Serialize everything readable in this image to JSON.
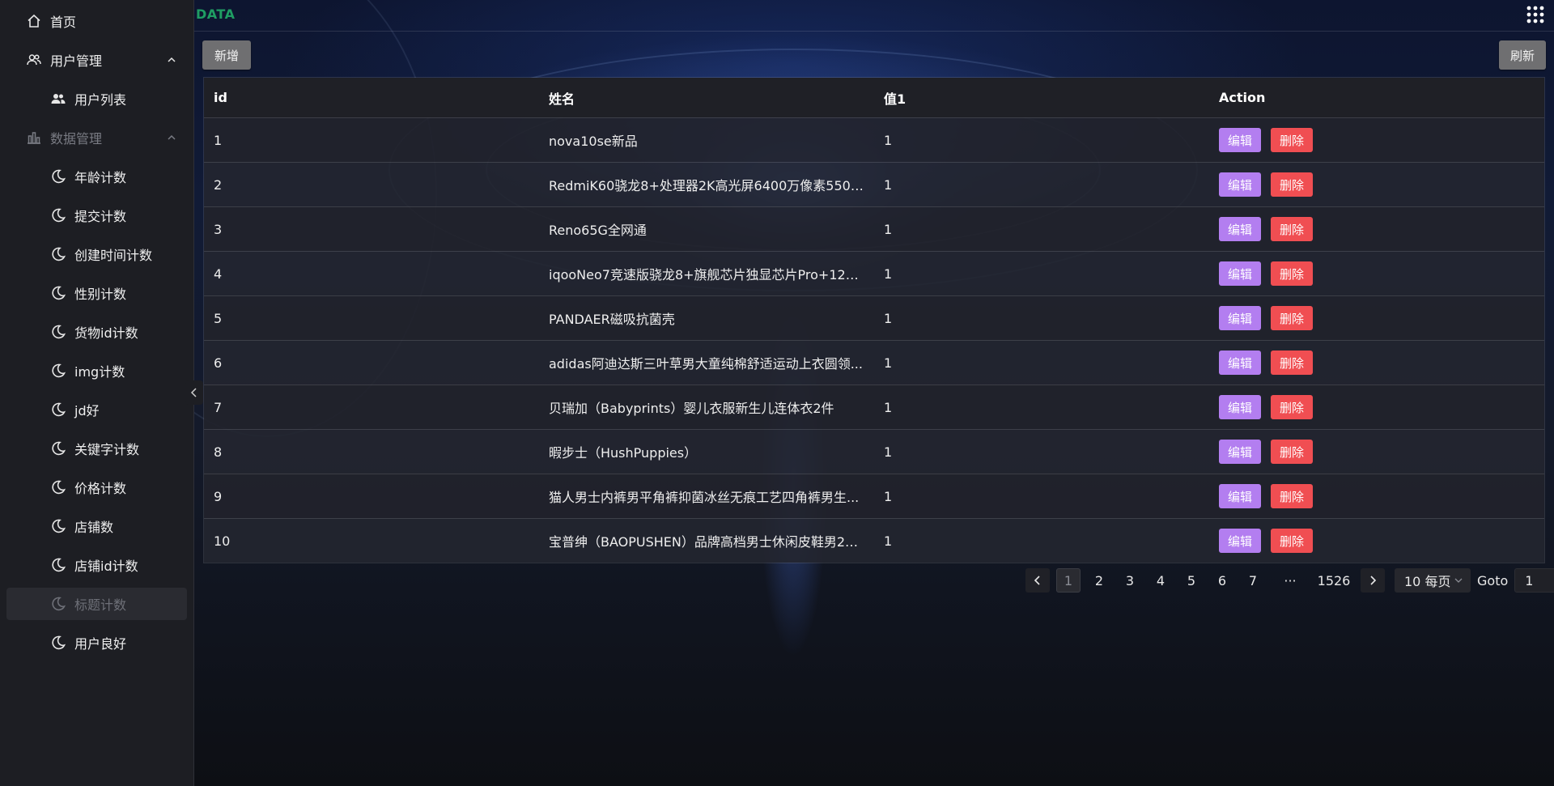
{
  "sidebar": {
    "home": "首页",
    "user_mgmt": "用户管理",
    "user_list": "用户列表",
    "data_mgmt": "数据管理",
    "items": [
      "年龄计数",
      "提交计数",
      "创建时间计数",
      "性别计数",
      "货物id计数",
      "img计数",
      "jd好",
      "关键字计数",
      "价格计数",
      "店铺数",
      "店铺id计数",
      "标题计数",
      "用户良好"
    ],
    "selected": "标题计数"
  },
  "header": {
    "logo": "DATA"
  },
  "toolbar": {
    "add_label": "新增",
    "refresh_label": "刷新"
  },
  "table": {
    "columns": [
      "id",
      "姓名",
      "值1",
      "Action"
    ],
    "edit_label": "编辑",
    "delete_label": "删除",
    "rows": [
      {
        "id": "1",
        "name": "nova10se新品",
        "val": "1"
      },
      {
        "id": "2",
        "name": "RedmiK60骁龙8+处理器2K高光屏6400万像素5500...",
        "val": "1"
      },
      {
        "id": "3",
        "name": "Reno65G全网通",
        "val": "1"
      },
      {
        "id": "4",
        "name": "iqooNeo7竞速版骁龙8+旗舰芯片独显芯片Pro+120...",
        "val": "1"
      },
      {
        "id": "5",
        "name": "PANDAER磁吸抗菌壳",
        "val": "1"
      },
      {
        "id": "6",
        "name": "adidas阿迪达斯三叶草男大童纯棉舒适运动上衣圆领...",
        "val": "1"
      },
      {
        "id": "7",
        "name": "贝瑞加（Babyprints）婴儿衣服新生儿连体衣2件",
        "val": "1"
      },
      {
        "id": "8",
        "name": "暇步士（HushPuppies）",
        "val": "1"
      },
      {
        "id": "9",
        "name": "猫人男士内裤男平角裤抑菌冰丝无痕工艺四角裤男生...",
        "val": "1"
      },
      {
        "id": "10",
        "name": "宝普绅（BAOPUSHEN）品牌高档男士休闲皮鞋男20...",
        "val": "1"
      }
    ]
  },
  "pagination": {
    "pages": [
      "1",
      "2",
      "3",
      "4",
      "5",
      "6",
      "7",
      "···",
      "1526"
    ],
    "current": "1",
    "page_size": "10 每页",
    "goto_label": "Goto",
    "goto_value": "1"
  },
  "colors": {
    "edit": "#b37ef0",
    "delete": "#f04e52",
    "logo": "#1f9d63",
    "sidebar_bg": "#1d1e23"
  }
}
